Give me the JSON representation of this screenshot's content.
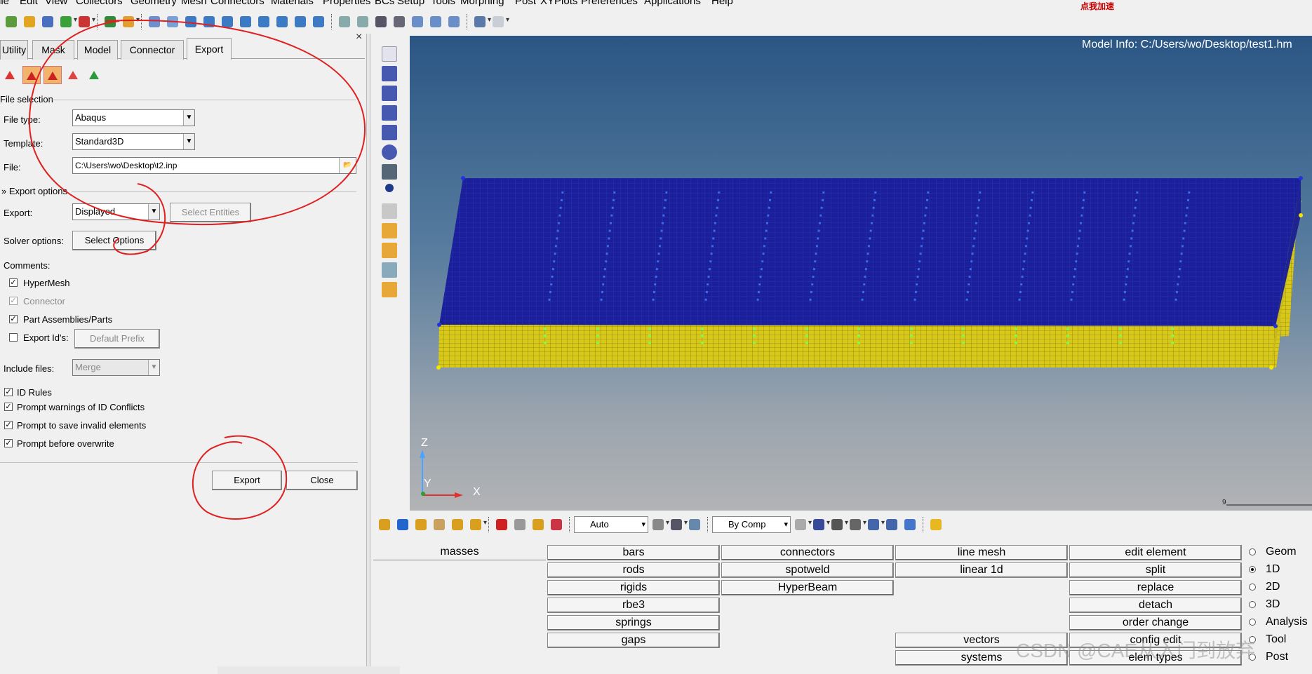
{
  "menubar": [
    "ile",
    "Edit",
    "View",
    "Collectors",
    "Geometry",
    "Mesh",
    "Connectors",
    "Materials",
    "Properties",
    "BCs",
    "Setup",
    "Tools",
    "Morphing",
    "Post",
    "XYPlots",
    "Preferences",
    "Applications",
    "Help"
  ],
  "promo": "点我加速",
  "panel": {
    "tabs": [
      "Utility",
      "Mask",
      "Model",
      "Connector",
      "Export"
    ],
    "active_tab": "Export",
    "file_selection": {
      "section_label": "File selection",
      "file_type_label": "File type:",
      "file_type_value": "Abaqus",
      "template_label": "Template:",
      "template_value": "Standard3D",
      "file_label": "File:",
      "file_value": "C:\\Users\\wo\\Desktop\\t2.inp"
    },
    "export_options": {
      "section_label": "Export options",
      "export_label": "Export:",
      "export_value": "Displayed",
      "select_entities_label": "Select Entities",
      "solver_options_label": "Solver options:",
      "select_options_label": "Select Options",
      "comments_label": "Comments:",
      "hypermesh_label": "HyperMesh",
      "hypermesh_checked": true,
      "connector_label": "Connector",
      "connector_checked": true,
      "part_assemblies_label": "Part Assemblies/Parts",
      "part_assemblies_checked": true,
      "export_ids_label": "Export Id's:",
      "export_ids_checked": false,
      "default_prefix_label": "Default Prefix",
      "include_files_label": "Include files:",
      "include_files_value": "Merge",
      "id_rules_label": "ID Rules",
      "prompt_conflicts_label": "Prompt warnings of ID Conflicts",
      "prompt_invalid_label": "Prompt to save invalid elements",
      "prompt_overwrite_label": "Prompt before overwrite"
    },
    "export_button": "Export",
    "close_button": "Close"
  },
  "viewport": {
    "model_info": "Model Info: C:/Users/wo/Desktop/test1.hm",
    "axis_z": "Z",
    "axis_y": "Y",
    "axis_x": "X",
    "ruler_label": "9"
  },
  "bottom_toolbar": {
    "display_mode": "Auto",
    "color_mode": "By Comp"
  },
  "menu": {
    "col1": [
      "masses"
    ],
    "col2": [
      "bars",
      "rods",
      "rigids",
      "rbe3",
      "springs",
      "gaps"
    ],
    "col3": [
      "connectors",
      "spotweld",
      "HyperBeam"
    ],
    "col4": [
      "line mesh",
      "linear 1d"
    ],
    "col4_bottom": [
      "vectors",
      "systems"
    ],
    "col5": [
      "edit element",
      "split",
      "replace",
      "detach",
      "order change",
      "config edit",
      "elem types"
    ],
    "radios": [
      "Geom",
      "1D",
      "2D",
      "3D",
      "Analysis",
      "Tool",
      "Post"
    ],
    "radio_selected": "1D"
  },
  "watermark": "CSDN @CAE从入门到放弃",
  "colors": {
    "mesh_top": "#1a1f9c",
    "mesh_bottom": "#d6c51c",
    "accent_red": "#e02020"
  }
}
